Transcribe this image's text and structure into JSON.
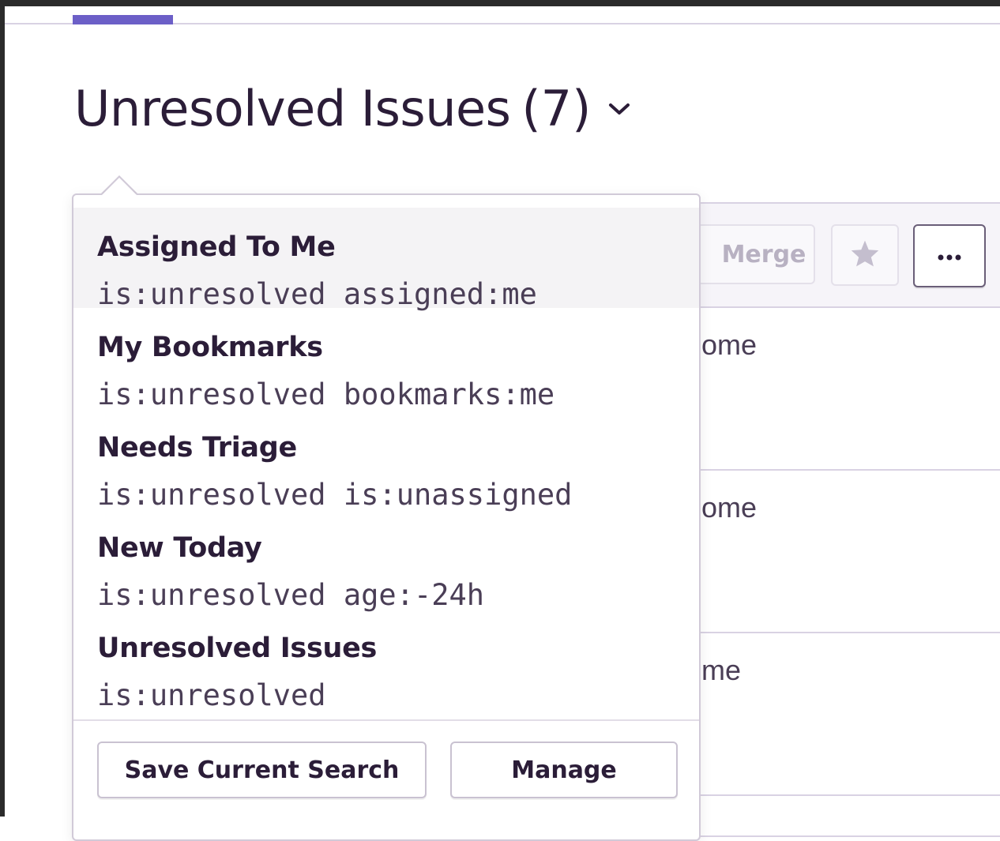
{
  "header": {
    "title": "Unresolved Issues",
    "count": "(7)"
  },
  "toolbar": {
    "merge_label": "Merge",
    "star_icon": "star-icon",
    "more_label": "•••"
  },
  "issue_rows": [
    {
      "fragment": "ome"
    },
    {
      "fragment": "ome"
    },
    {
      "fragment": "me"
    }
  ],
  "saved_searches": {
    "items": [
      {
        "name": "Assigned To Me",
        "query": "is:unresolved assigned:me"
      },
      {
        "name": "My Bookmarks",
        "query": "is:unresolved bookmarks:me"
      },
      {
        "name": "Needs Triage",
        "query": "is:unresolved is:unassigned"
      },
      {
        "name": "New Today",
        "query": "is:unresolved age:-24h"
      },
      {
        "name": "Unresolved Issues",
        "query": "is:unresolved"
      }
    ],
    "save_label": "Save Current Search",
    "manage_label": "Manage"
  },
  "colors": {
    "accent": "#6c5fc7",
    "text": "#2b1d38",
    "border": "#d9d2e3",
    "highlight": "#f4f3f5"
  }
}
